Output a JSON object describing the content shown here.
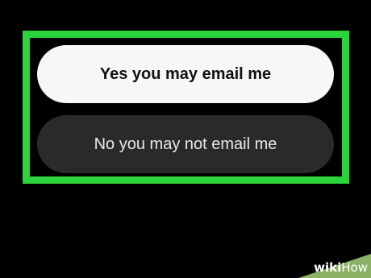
{
  "dialog": {
    "options": [
      {
        "label": "Yes you may email me"
      },
      {
        "label": "No you may not email me"
      }
    ]
  },
  "watermark": {
    "part1": "wiki",
    "part2": "How"
  },
  "colors": {
    "background": "#000000",
    "highlight": "#2ad43a",
    "yes_button": "#f7f7f7",
    "no_button": "#2a2a2a",
    "watermark_bg": "#8bb264"
  }
}
